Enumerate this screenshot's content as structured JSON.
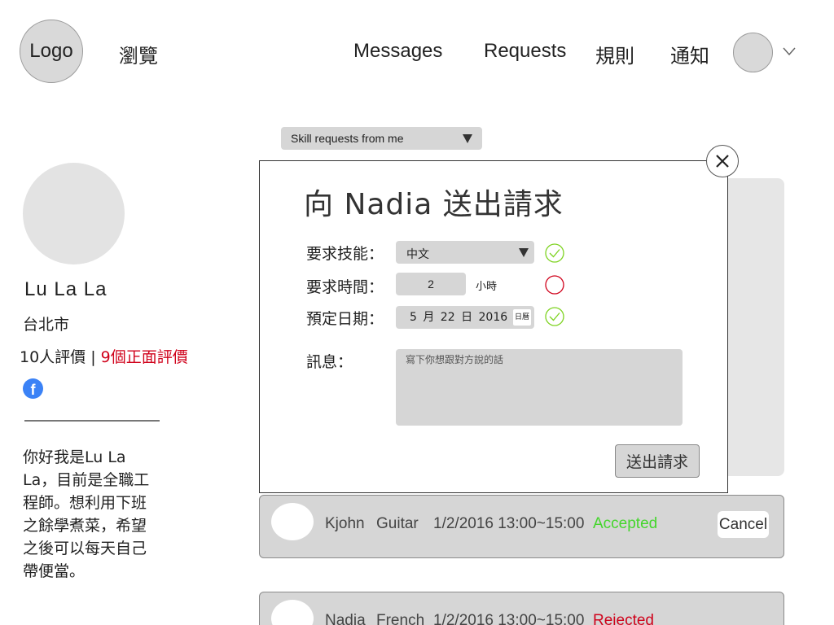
{
  "header": {
    "logo_text": "Logo",
    "browse_label": "瀏覽",
    "nav": {
      "messages": "Messages",
      "requests": "Requests",
      "rules": "規則",
      "notifications": "通知"
    },
    "user_menu_icon": "chevron-down-icon"
  },
  "profile": {
    "name": "Lu La La",
    "city": "台北市",
    "reviews_count": "10人評價",
    "reviews_separator": " | ",
    "reviews_positive": "9個正面評價",
    "social_icon": "facebook-icon",
    "bio": "你好我是Lu La La，目前是全職工程師。想利用下班之餘學煮菜，希望之後可以每天自己帶便當。"
  },
  "filter": {
    "selected": "Skill requests from me"
  },
  "modal": {
    "title": "向 Nadia 送出請求",
    "labels": {
      "skill": "要求技能：",
      "time": "要求時間：",
      "date": "預定日期：",
      "message": "訊息："
    },
    "skill_value": "中文",
    "time_value": "2",
    "time_unit": "小時",
    "date_value": "5 月 22 日 2016",
    "date_picker_label": "日曆",
    "message_placeholder": "寫下你想跟對方說的話",
    "submit_label": "送出請求",
    "validation": {
      "skill": "valid",
      "time": "invalid",
      "date": "valid"
    },
    "colors": {
      "valid": "#7ed321",
      "invalid": "#d0021b"
    }
  },
  "requests": [
    {
      "name": "Kjohn",
      "skill": "Guitar",
      "time": "1/2/2016 13:00~15:00",
      "status": "Accepted",
      "status_color": "#44d62c",
      "action": "Cancel"
    },
    {
      "name": "Nadia",
      "skill": "French",
      "time": "1/2/2016 13:00~15:00",
      "status": "Rejected",
      "status_color": "#d0021b"
    }
  ]
}
